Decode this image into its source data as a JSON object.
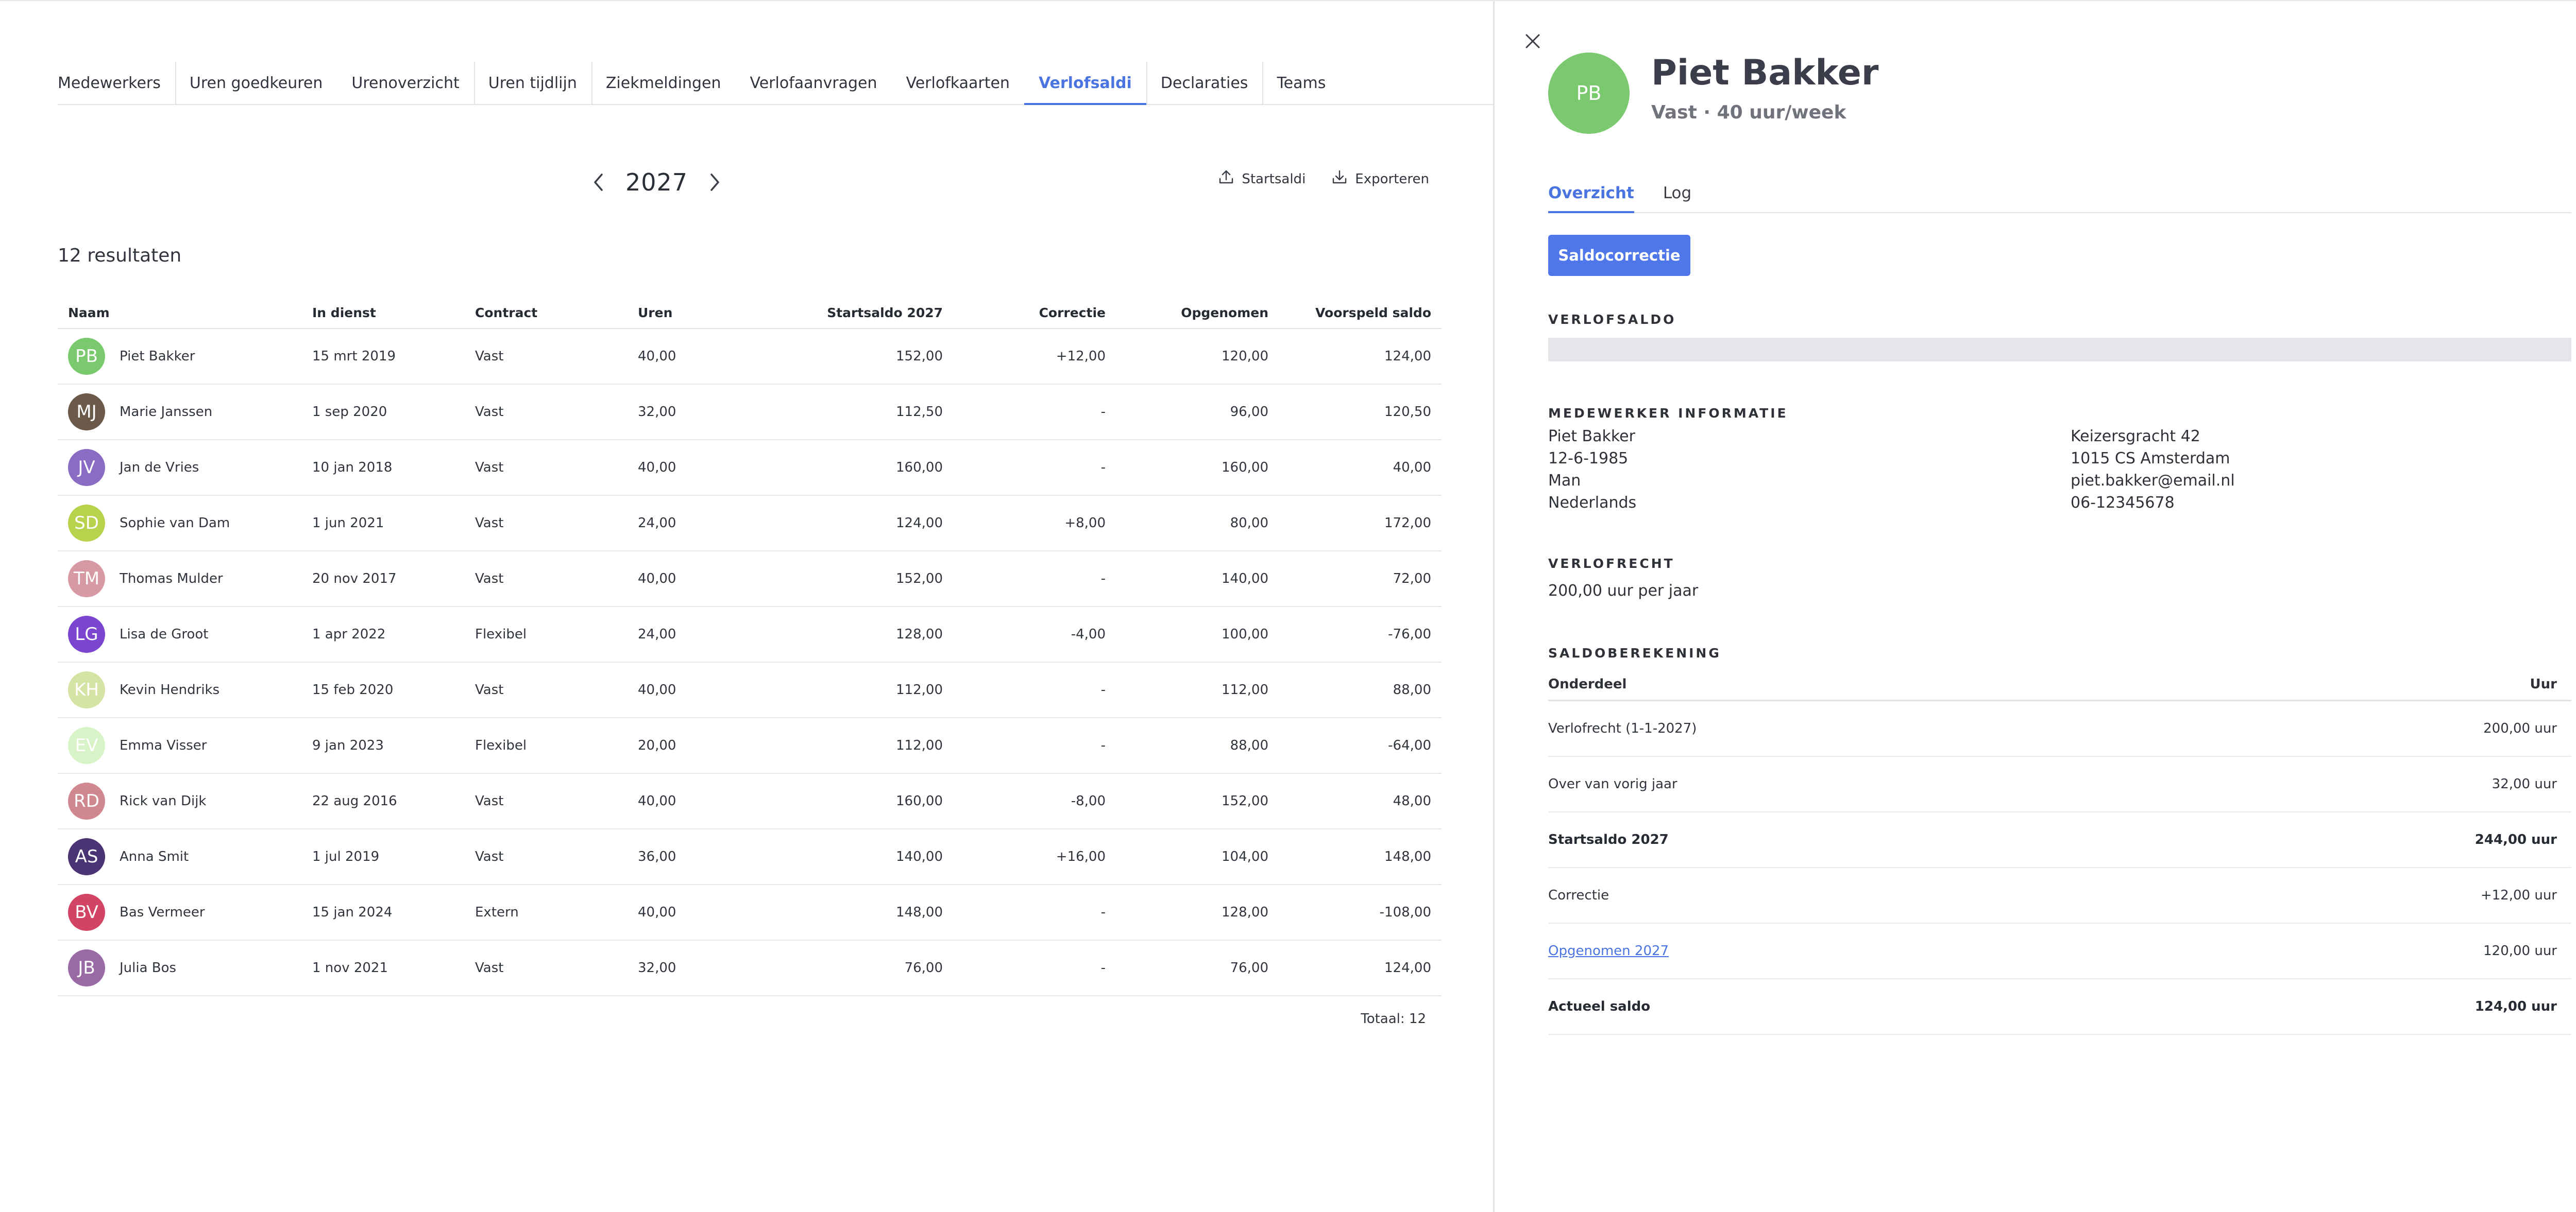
{
  "tabs": [
    "Medewerkers",
    "Uren goedkeuren",
    "Urenoverzicht",
    "Uren tijdlijn",
    "Ziekmeldingen",
    "Verlofaanvragen",
    "Verlofkaarten",
    "Verlofsaldi",
    "Declaraties",
    "Teams"
  ],
  "active_tab": "Verlofsaldi",
  "year_nav": {
    "year": "2027",
    "prev_icon": "chevron-left-icon",
    "next_icon": "chevron-right-icon"
  },
  "actions": {
    "startsaldi": "Startsaldi",
    "exporteren": "Exporteren"
  },
  "results_label": "12 resultaten",
  "table": {
    "headers": {
      "naam": "Naam",
      "in_dienst": "In dienst",
      "contract": "Contract",
      "uren": "Uren",
      "startsaldo": "Startsaldo 2027",
      "correctie": "Correctie",
      "opgenomen": "Opgenomen",
      "voorspeld": "Voorspeld saldo"
    },
    "rows": [
      {
        "initials": "PB",
        "color": "#7ac96f",
        "name": "Piet Bakker",
        "in_dienst": "15 mrt 2019",
        "contract": "Vast",
        "uren": "40,00",
        "startsaldo": "152,00",
        "correctie": "+12,00",
        "opgenomen": "120,00",
        "voorspeld": "124,00"
      },
      {
        "initials": "MJ",
        "color": "#6b5a4a",
        "name": "Marie Janssen",
        "in_dienst": "1 sep 2020",
        "contract": "Vast",
        "uren": "32,00",
        "startsaldo": "112,50",
        "correctie": "-",
        "opgenomen": "96,00",
        "voorspeld": "120,50"
      },
      {
        "initials": "JV",
        "color": "#8a6cc4",
        "name": "Jan de Vries",
        "in_dienst": "10 jan 2018",
        "contract": "Vast",
        "uren": "40,00",
        "startsaldo": "160,00",
        "correctie": "-",
        "opgenomen": "160,00",
        "voorspeld": "40,00"
      },
      {
        "initials": "SD",
        "color": "#b8d24e",
        "name": "Sophie van Dam",
        "in_dienst": "1 jun 2021",
        "contract": "Vast",
        "uren": "24,00",
        "startsaldo": "124,00",
        "correctie": "+8,00",
        "opgenomen": "80,00",
        "voorspeld": "172,00"
      },
      {
        "initials": "TM",
        "color": "#d79aa4",
        "name": "Thomas Mulder",
        "in_dienst": "20 nov 2017",
        "contract": "Vast",
        "uren": "40,00",
        "startsaldo": "152,00",
        "correctie": "-",
        "opgenomen": "140,00",
        "voorspeld": "72,00"
      },
      {
        "initials": "LG",
        "color": "#7b45d0",
        "name": "Lisa de Groot",
        "in_dienst": "1 apr 2022",
        "contract": "Flexibel",
        "uren": "24,00",
        "startsaldo": "128,00",
        "correctie": "-4,00",
        "opgenomen": "100,00",
        "voorspeld": "-76,00"
      },
      {
        "initials": "KH",
        "color": "#d5e4a4",
        "name": "Kevin Hendriks",
        "in_dienst": "15 feb 2020",
        "contract": "Vast",
        "uren": "40,00",
        "startsaldo": "112,00",
        "correctie": "-",
        "opgenomen": "112,00",
        "voorspeld": "88,00"
      },
      {
        "initials": "EV",
        "color": "#d9f3c9",
        "name": "Emma Visser",
        "in_dienst": "9 jan 2023",
        "contract": "Flexibel",
        "uren": "20,00",
        "startsaldo": "112,00",
        "correctie": "-",
        "opgenomen": "88,00",
        "voorspeld": "-64,00"
      },
      {
        "initials": "RD",
        "color": "#cf8890",
        "name": "Rick van Dijk",
        "in_dienst": "22 aug 2016",
        "contract": "Vast",
        "uren": "40,00",
        "startsaldo": "160,00",
        "correctie": "-8,00",
        "opgenomen": "152,00",
        "voorspeld": "48,00"
      },
      {
        "initials": "AS",
        "color": "#4a3474",
        "name": "Anna Smit",
        "in_dienst": "1 jul 2019",
        "contract": "Vast",
        "uren": "36,00",
        "startsaldo": "140,00",
        "correctie": "+16,00",
        "opgenomen": "104,00",
        "voorspeld": "148,00"
      },
      {
        "initials": "BV",
        "color": "#d24466",
        "name": "Bas Vermeer",
        "in_dienst": "15 jan 2024",
        "contract": "Extern",
        "uren": "40,00",
        "startsaldo": "148,00",
        "correctie": "-",
        "opgenomen": "128,00",
        "voorspeld": "-108,00"
      },
      {
        "initials": "JB",
        "color": "#9a6aa4",
        "name": "Julia Bos",
        "in_dienst": "1 nov 2021",
        "contract": "Vast",
        "uren": "32,00",
        "startsaldo": "76,00",
        "correctie": "-",
        "opgenomen": "76,00",
        "voorspeld": "124,00"
      }
    ]
  },
  "total_label": "Totaal: 12",
  "panel": {
    "initials": "PB",
    "avatar_color": "#7ac96f",
    "name": "Piet Bakker",
    "subtitle": "Vast · 40 uur/week",
    "tabs": [
      "Overzicht",
      "Log"
    ],
    "active_tab": "Overzicht",
    "button_label": "Saldocorrectie",
    "verlofsaldo_title": "VERLOFSALDO",
    "info_title": "MEDEWERKER INFORMATIE",
    "info_left": [
      "Piet Bakker",
      "12-6-1985",
      "Man",
      "Nederlands"
    ],
    "info_right": [
      "Keizersgracht 42",
      "1015 CS Amsterdam",
      "piet.bakker@email.nl",
      "06-12345678"
    ],
    "verlofrecht_title": "VERLOFRECHT",
    "verlofrecht_value": "200,00 uur per jaar",
    "saldo_title": "SALDOBEREKENING",
    "calc_headers": {
      "onderdeel": "Onderdeel",
      "uur": "Uur"
    },
    "calc_rows": [
      {
        "label": "Verlofrecht (1-1-2027)",
        "value": "200,00 uur",
        "bold": false,
        "link": false
      },
      {
        "label": "Over van vorig jaar",
        "value": "32,00 uur",
        "bold": false,
        "link": false
      },
      {
        "label": "Startsaldo 2027",
        "value": "244,00 uur",
        "bold": true,
        "link": false
      },
      {
        "label": "Correctie",
        "value": "+12,00 uur",
        "bold": false,
        "link": false
      },
      {
        "label": "Opgenomen 2027",
        "value": "120,00 uur",
        "bold": false,
        "link": true
      },
      {
        "label": "Actueel saldo",
        "value": "124,00 uur",
        "bold": true,
        "link": false
      }
    ]
  },
  "colors": {
    "accent": "#4a74e0",
    "button": "#4f77ea",
    "border": "#e3e4e8"
  }
}
